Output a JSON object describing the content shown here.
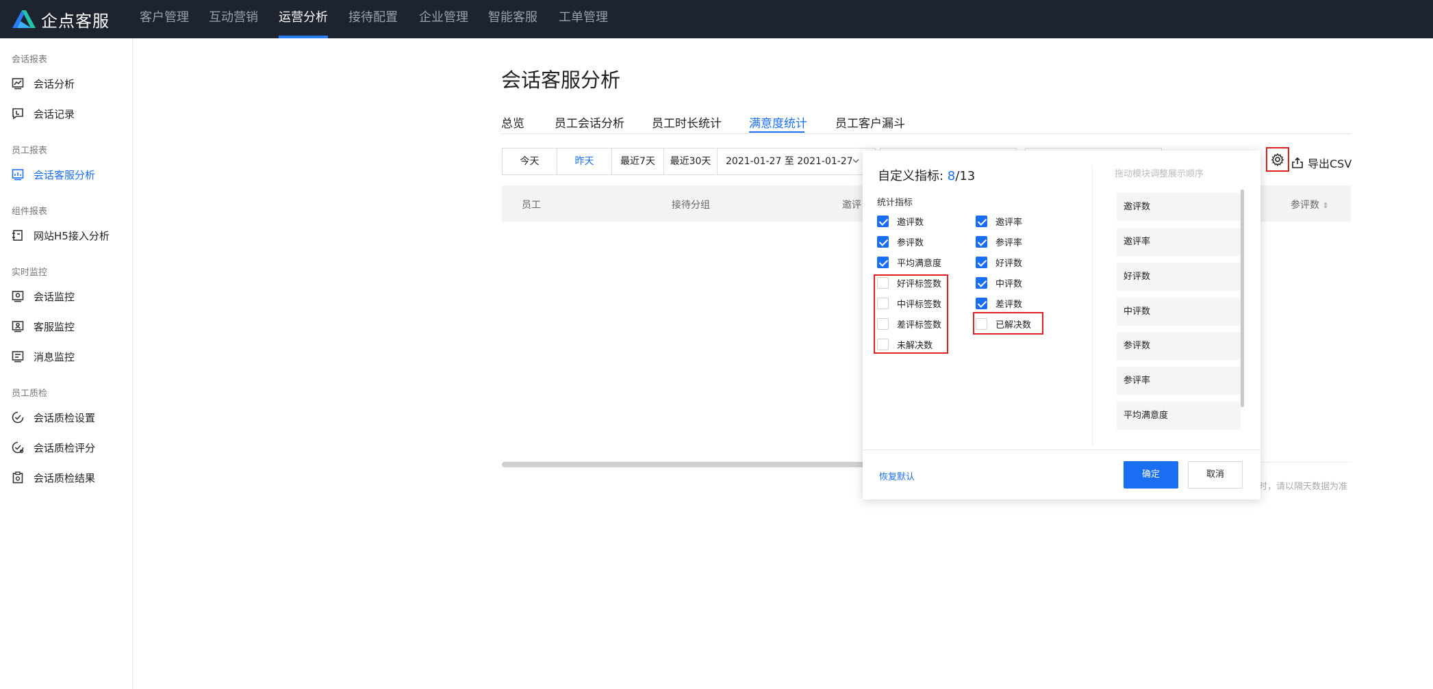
{
  "app": {
    "logo_text": "企点客服"
  },
  "nav": [
    {
      "label": "客户管理"
    },
    {
      "label": "互动营销"
    },
    {
      "label": "运营分析",
      "active": true
    },
    {
      "label": "接待配置"
    },
    {
      "label": "企业管理"
    },
    {
      "label": "智能客服"
    },
    {
      "label": "工单管理"
    }
  ],
  "sidebar": {
    "groups": [
      {
        "title": "会话报表",
        "items": [
          {
            "label": "会话分析",
            "icon": "line-chart-icon"
          },
          {
            "label": "会话记录",
            "icon": "chat-record-icon"
          }
        ]
      },
      {
        "title": "员工报表",
        "items": [
          {
            "label": "会话客服分析",
            "icon": "agent-analysis-icon",
            "active": true
          }
        ]
      },
      {
        "title": "组件报表",
        "items": [
          {
            "label": "网站H5接入分析",
            "icon": "h5-icon"
          }
        ]
      },
      {
        "title": "实时监控",
        "items": [
          {
            "label": "会话监控",
            "icon": "monitor-icon"
          },
          {
            "label": "客服监控",
            "icon": "agent-monitor-icon"
          },
          {
            "label": "消息监控",
            "icon": "message-monitor-icon"
          }
        ]
      },
      {
        "title": "员工质检",
        "items": [
          {
            "label": "会话质检设置",
            "icon": "qc-settings-icon"
          },
          {
            "label": "会话质检评分",
            "icon": "qc-score-icon"
          },
          {
            "label": "会话质检结果",
            "icon": "qc-result-icon"
          }
        ]
      }
    ]
  },
  "page": {
    "title": "会话客服分析",
    "tabs": [
      {
        "label": "总览"
      },
      {
        "label": "员工会话分析"
      },
      {
        "label": "员工时长统计"
      },
      {
        "label": "满意度统计",
        "active": true
      },
      {
        "label": "员工客户漏斗"
      }
    ]
  },
  "filters": {
    "quick": [
      {
        "label": "今天"
      },
      {
        "label": "昨天",
        "active": true
      },
      {
        "label": "最近7天"
      },
      {
        "label": "最近30天"
      }
    ],
    "date_range": "2021-01-27 至 2021-01-27"
  },
  "toolbar": {
    "export_label": "导出CSV",
    "settings_icon": "gear-icon"
  },
  "table": {
    "headers": [
      "员工",
      "接待分组",
      "邀评",
      "参评数"
    ],
    "sort_indicator": "⇕"
  },
  "footnote": "时，请以隔天数据为准",
  "popup": {
    "title_prefix": "自定义指标: ",
    "selected": "8",
    "total": "/13",
    "section_label": "统计指标",
    "left_col": [
      {
        "label": "邀评数",
        "checked": true
      },
      {
        "label": "参评数",
        "checked": true
      },
      {
        "label": "平均满意度",
        "checked": true
      },
      {
        "label": "好评标签数",
        "checked": false
      },
      {
        "label": "中评标签数",
        "checked": false
      },
      {
        "label": "差评标签数",
        "checked": false
      },
      {
        "label": "未解决数",
        "checked": false
      }
    ],
    "right_col": [
      {
        "label": "邀评率",
        "checked": true
      },
      {
        "label": "参评率",
        "checked": true
      },
      {
        "label": "好评数",
        "checked": true
      },
      {
        "label": "中评数",
        "checked": true
      },
      {
        "label": "差评数",
        "checked": true
      },
      {
        "label": "已解决数",
        "checked": false
      }
    ],
    "drag_hint": "拖动模块调整展示顺序",
    "order": [
      "邀评数",
      "邀评率",
      "好评数",
      "中评数",
      "参评数",
      "参评率",
      "平均满意度"
    ],
    "restore_label": "恢复默认",
    "ok_label": "确定",
    "cancel_label": "取消"
  },
  "colors": {
    "accent": "#1a6ef2",
    "topbar": "#1e2330",
    "highlight": "#e02020"
  }
}
